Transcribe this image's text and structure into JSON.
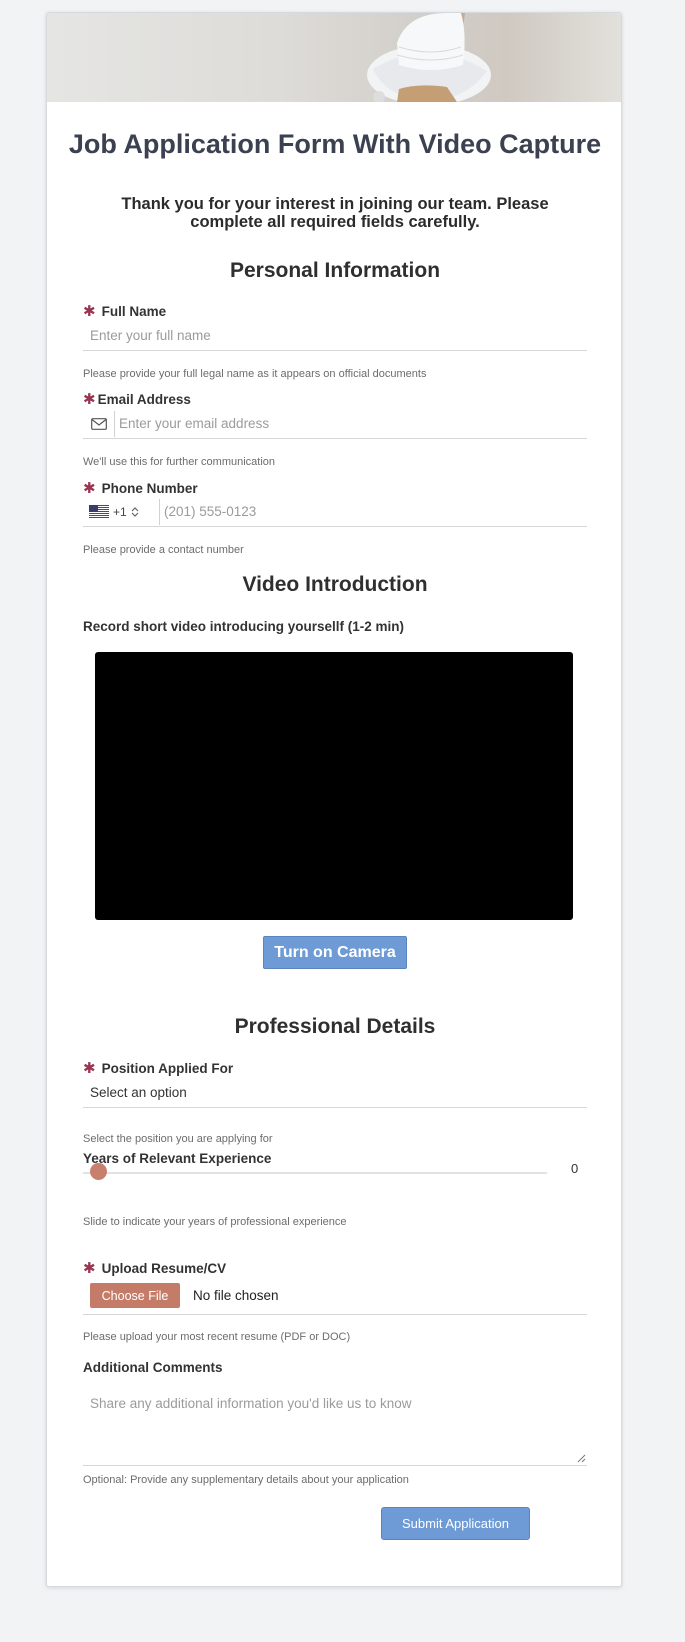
{
  "form": {
    "title": "Job Application Form With Video Capture",
    "intro": "Thank you for your interest in joining our team. Please complete all required fields carefully.",
    "required_marker": "✱"
  },
  "personal": {
    "section_title": "Personal Information",
    "full_name": {
      "label": "Full Name",
      "placeholder": "Enter your full name",
      "help": "Please provide your full legal name as it appears on official documents"
    },
    "email": {
      "label": "Email Address",
      "placeholder": "Enter your email address",
      "help": "We'll use this for further communication",
      "icon": "mail-icon"
    },
    "phone": {
      "label": "Phone Number",
      "country_code": "+1",
      "country_flag": "us-flag-icon",
      "placeholder": "(201) 555-0123",
      "help": "Please provide a contact number"
    }
  },
  "video": {
    "section_title": "Video Introduction",
    "prompt": "Record short video introducing yoursellf (1-2 min)",
    "camera_button": "Turn on Camera"
  },
  "professional": {
    "section_title": "Professional Details",
    "position": {
      "label": "Position Applied For",
      "selected": "Select an option",
      "help": "Select the position you are applying for"
    },
    "experience": {
      "label": "Years of Relevant Experience",
      "value": "0",
      "help": "Slide to indicate your years of professional experience"
    },
    "resume": {
      "label": "Upload Resume/CV",
      "button": "Choose File",
      "status": "No file chosen",
      "help": "Please upload your most recent resume (PDF or DOC)"
    },
    "comments": {
      "label": "Additional Comments",
      "placeholder": "Share any additional information you'd like us to know",
      "help": "Optional: Provide any supplementary details about your application"
    }
  },
  "submit_label": "Submit Application",
  "colors": {
    "accent_blue": "#6e9bd6",
    "accent_terracotta": "#c47c68",
    "required_red": "#9a3450"
  }
}
